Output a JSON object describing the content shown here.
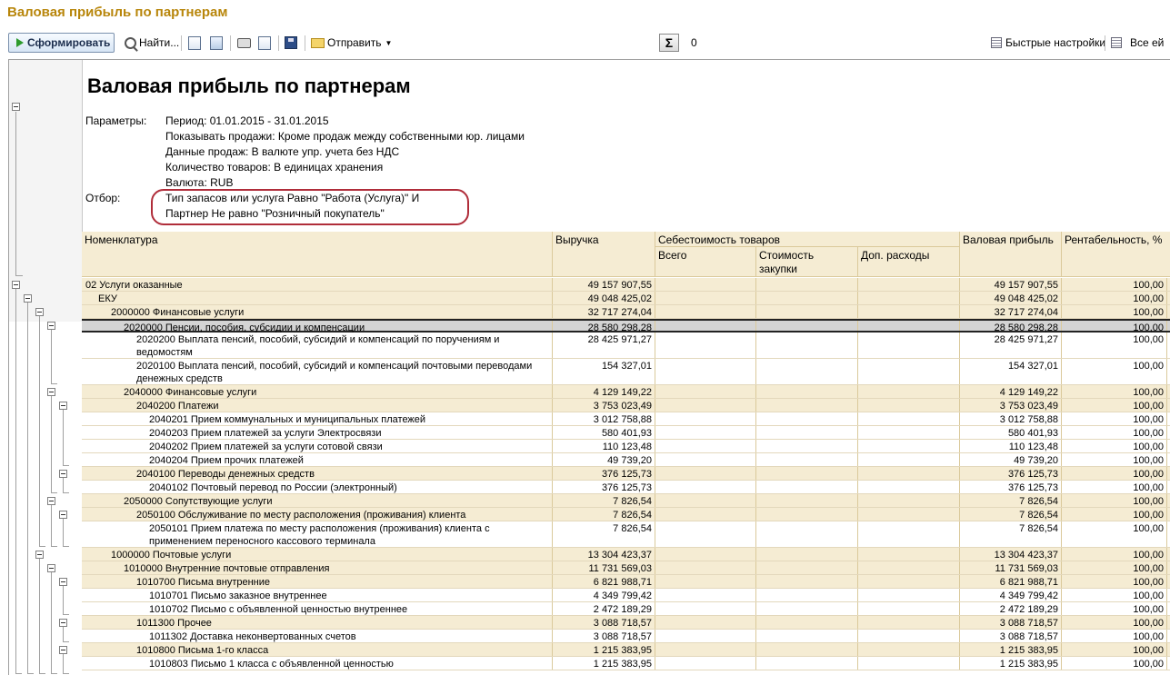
{
  "window_title": "Валовая прибыль по партнерам",
  "toolbar": {
    "generate_label": "Сформировать",
    "find_label": "Найти...",
    "send_label": "Отправить",
    "sum_symbol": "Σ",
    "sum_value": "0",
    "quick_settings_label": "Быстрые настройки",
    "all_settings_label": "Все ей"
  },
  "report": {
    "title": "Валовая прибыль по партнерам",
    "params_label": "Параметры:",
    "params": [
      "Период: 01.01.2015 - 31.01.2015",
      "Показывать продажи: Кроме продаж между собственными юр. лицами",
      "Данные продаж: В валюте упр. учета без НДС",
      "Количество товаров: В единицах хранения",
      "Валюта: RUB"
    ],
    "filter_label": "Отбор:",
    "filter": [
      "Тип запасов или услуга Равно \"Работа (Услуга)\" И",
      "Партнер Не равно \"Розничный покупатель\""
    ]
  },
  "table": {
    "headers": {
      "name": "Номенклатура",
      "revenue": "Выручка",
      "cost_group": "Себестоимость товаров",
      "total": "Всего",
      "purchase": "Стоимость закупки",
      "extra": "Доп. расходы",
      "gross": "Валовая прибыль",
      "profitability": "Рентабельность, %"
    },
    "rows": [
      {
        "name": "02 Услуги оказанные",
        "revenue": "49 157 907,55",
        "gross": "49 157 907,55",
        "pct": "100,00",
        "level": 0
      },
      {
        "name": "ЕКУ",
        "revenue": "49 048 425,02",
        "gross": "49 048 425,02",
        "pct": "100,00",
        "level": 1
      },
      {
        "name": "2000000 Финансовые услуги",
        "revenue": "32 717 274,04",
        "gross": "32 717 274,04",
        "pct": "100,00",
        "level": 2
      },
      {
        "name": "2020000 Пенсии, пособия, субсидии и компенсации",
        "revenue": "28 580 298,28",
        "gross": "28 580 298,28",
        "pct": "100,00",
        "level": 3
      },
      {
        "name": "2020200 Выплата пенсий, пособий, субсидий и компенсаций по поручениям и ведомостям",
        "revenue": "28 425 971,27",
        "gross": "28 425 971,27",
        "pct": "100,00",
        "level": 4
      },
      {
        "name": "2020100 Выплата пенсий, пособий, субсидий и компенсаций почтовыми переводами денежных средств",
        "revenue": "154 327,01",
        "gross": "154 327,01",
        "pct": "100,00",
        "level": 4
      },
      {
        "name": "2040000 Финансовые услуги",
        "revenue": "4 129 149,22",
        "gross": "4 129 149,22",
        "pct": "100,00",
        "level": 3
      },
      {
        "name": "2040200 Платежи",
        "revenue": "3 753 023,49",
        "gross": "3 753 023,49",
        "pct": "100,00",
        "level": 4
      },
      {
        "name": "2040201 Прием коммунальных и муниципальных платежей",
        "revenue": "3 012 758,88",
        "gross": "3 012 758,88",
        "pct": "100,00",
        "level": 5
      },
      {
        "name": "2040203 Прием платежей за услуги Электросвязи",
        "revenue": "580 401,93",
        "gross": "580 401,93",
        "pct": "100,00",
        "level": 5
      },
      {
        "name": "2040202 Прием платежей за услуги сотовой связи",
        "revenue": "110 123,48",
        "gross": "110 123,48",
        "pct": "100,00",
        "level": 5
      },
      {
        "name": "2040204 Прием прочих платежей",
        "revenue": "49 739,20",
        "gross": "49 739,20",
        "pct": "100,00",
        "level": 5
      },
      {
        "name": "2040100 Переводы денежных средств",
        "revenue": "376 125,73",
        "gross": "376 125,73",
        "pct": "100,00",
        "level": 4
      },
      {
        "name": "2040102 Почтовый перевод по России (электронный)",
        "revenue": "376 125,73",
        "gross": "376 125,73",
        "pct": "100,00",
        "level": 5
      },
      {
        "name": "2050000 Сопутствующие услуги",
        "revenue": "7 826,54",
        "gross": "7 826,54",
        "pct": "100,00",
        "level": 3
      },
      {
        "name": "2050100 Обслуживание по месту расположения (проживания) клиента",
        "revenue": "7 826,54",
        "gross": "7 826,54",
        "pct": "100,00",
        "level": 4
      },
      {
        "name": "2050101 Прием платежа по месту расположения (проживания) клиента с применением переносного кассового терминала",
        "revenue": "7 826,54",
        "gross": "7 826,54",
        "pct": "100,00",
        "level": 5
      },
      {
        "name": "1000000 Почтовые услуги",
        "revenue": "13 304 423,37",
        "gross": "13 304 423,37",
        "pct": "100,00",
        "level": 2
      },
      {
        "name": "1010000 Внутренние почтовые отправления",
        "revenue": "11 731 569,03",
        "gross": "11 731 569,03",
        "pct": "100,00",
        "level": 3
      },
      {
        "name": "1010700 Письма внутренние",
        "revenue": "6 821 988,71",
        "gross": "6 821 988,71",
        "pct": "100,00",
        "level": 4
      },
      {
        "name": "1010701 Письмо заказное внутреннее",
        "revenue": "4 349 799,42",
        "gross": "4 349 799,42",
        "pct": "100,00",
        "level": 5
      },
      {
        "name": "1010702 Письмо с объявленной ценностью внутреннее",
        "revenue": "2 472 189,29",
        "gross": "2 472 189,29",
        "pct": "100,00",
        "level": 5
      },
      {
        "name": "1011300 Прочее",
        "revenue": "3 088 718,57",
        "gross": "3 088 718,57",
        "pct": "100,00",
        "level": 4
      },
      {
        "name": "1011302 Доставка неконвертованных счетов",
        "revenue": "3 088 718,57",
        "gross": "3 088 718,57",
        "pct": "100,00",
        "level": 5
      },
      {
        "name": "1010800 Письма 1-го класса",
        "revenue": "1 215 383,95",
        "gross": "1 215 383,95",
        "pct": "100,00",
        "level": 4
      },
      {
        "name": "1010803 Письмо 1 класса с объявленной ценностью",
        "revenue": "1 215 383,95",
        "gross": "1 215 383,95",
        "pct": "100,00",
        "level": 5
      }
    ]
  }
}
